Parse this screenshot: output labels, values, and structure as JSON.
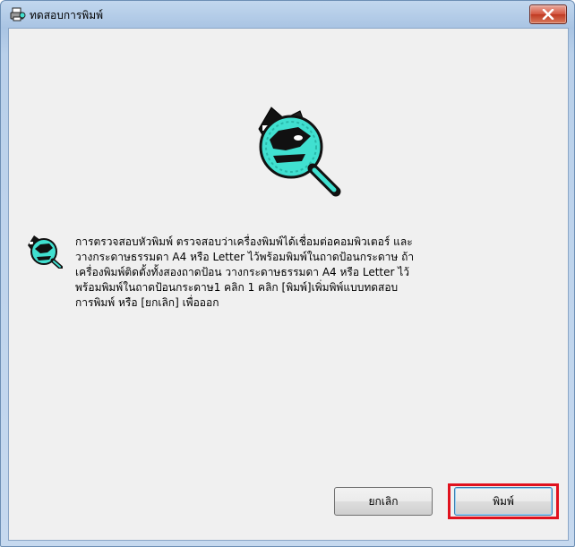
{
  "window": {
    "title": "ทดสอบการพิมพ์",
    "close_icon": "close-icon"
  },
  "dialog": {
    "message": "การตรวจสอบหัวพิมพ์ ตรวจสอบว่าเครื่องพิมพ์ได้เชื่อมต่อคอมพิวเตอร์ และ\nวางกระดาษธรรมดา A4 หรือ Letter ไว้พร้อมพิมพ์ในถาดป้อนกระดาษ ถ้า\nเครื่องพิมพ์ติดตั้งทั้งสองถาดป้อน วางกระดาษธรรมดา A4 หรือ Letter ไว้\nพร้อมพิมพ์ในถาดป้อนกระดาษ1 คลิก 1 คลิก [พิมพ์]เพิ่มพิพ์แบบทดสอบ\nการพิมพ์ หรือ [ยกเลิก] เพื่อออก",
    "hero_icon": "print-test-magnifier-icon",
    "message_icon": "print-head-inspect-icon"
  },
  "buttons": {
    "cancel_label": "ยกเลิก",
    "print_label": "พิมพ์"
  },
  "colors": {
    "highlight": "#e0121e",
    "magnifier_fill": "#40e0d0"
  }
}
